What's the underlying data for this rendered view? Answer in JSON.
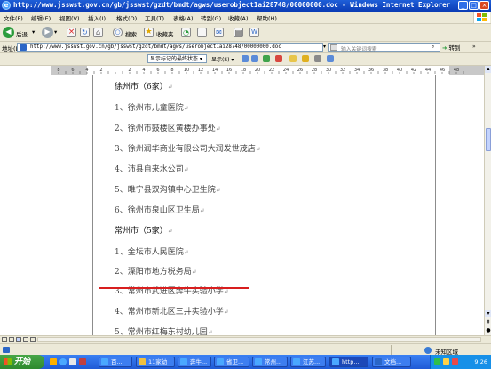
{
  "window": {
    "title": "http://www.jsswst.gov.cn/gb/jsswst/gzdt/bmdt/agws/userobject1ai28748/00000000.doc - Windows Internet Explorer"
  },
  "menu": [
    "文件(F)",
    "编辑(E)",
    "视图(V)",
    "插入(I)",
    "格式(O)",
    "工具(T)",
    "表格(A)",
    "转到(G)",
    "收藏(A)",
    "帮助(H)"
  ],
  "nav": {
    "back_label": "后退",
    "search_label": "搜索",
    "favorites_label": "收藏夹"
  },
  "address": {
    "label": "地址(D)",
    "url": "http://www.jsswst.gov.cn/gb/jsswst/gzdt/bmdt/agws/userobject1ai28748/00000000.doc",
    "search_placeholder": "输入关键词搜索",
    "go_label": "转到"
  },
  "wordbar": {
    "markup_select": "显示标记的最终状态",
    "show_label": "显示(S)"
  },
  "ruler": {
    "numbers": [
      "8",
      "6",
      "4",
      "2",
      "",
      "2",
      "4",
      "6",
      "8",
      "10",
      "12",
      "14",
      "16",
      "18",
      "20",
      "22",
      "24",
      "26",
      "28",
      "30",
      "32",
      "34",
      "36",
      "38",
      "40",
      "42",
      "44",
      "46",
      "48"
    ]
  },
  "document": {
    "paragraph_mark": "↵",
    "lines": [
      {
        "text": "徐州市（6家）",
        "heading": true
      },
      {
        "text": "1、徐州市儿童医院",
        "heading": false
      },
      {
        "text": "2、徐州市鼓楼区黄楼办事处",
        "heading": false
      },
      {
        "text": "3、徐州润华商业有限公司大润发世茂店",
        "heading": false
      },
      {
        "text": "4、沛县自来水公司",
        "heading": false
      },
      {
        "text": "5、睢宁县双沟镇中心卫生院",
        "heading": false
      },
      {
        "text": "6、徐州市泉山区卫生局",
        "heading": false
      },
      {
        "text": "常州市（5家）",
        "heading": true
      },
      {
        "text": "1、金坛市人民医院",
        "heading": false
      },
      {
        "text": "2、溧阳市地方税务局",
        "heading": false
      },
      {
        "text": "3、常州市武进区奔牛实验小学",
        "heading": false
      },
      {
        "text": "4、常州市新北区三井实验小学",
        "heading": false
      },
      {
        "text": "5、常州市红梅东村幼儿园",
        "heading": false
      }
    ]
  },
  "status": {
    "zone": "未知区域"
  },
  "taskbar": {
    "start_label": "开始",
    "buttons": [
      "百...",
      "11家幼",
      "奔牛...",
      "省卫...",
      "常州...",
      "江苏...",
      "http...",
      "文档..."
    ],
    "clock": "9:26"
  },
  "colors": {
    "titlebar": "#0a3bb5",
    "chrome": "#ece9d8",
    "highlight_underline": "#d81e1e",
    "start_button": "#2f8a2f",
    "taskbar": "#1f5ad6"
  }
}
